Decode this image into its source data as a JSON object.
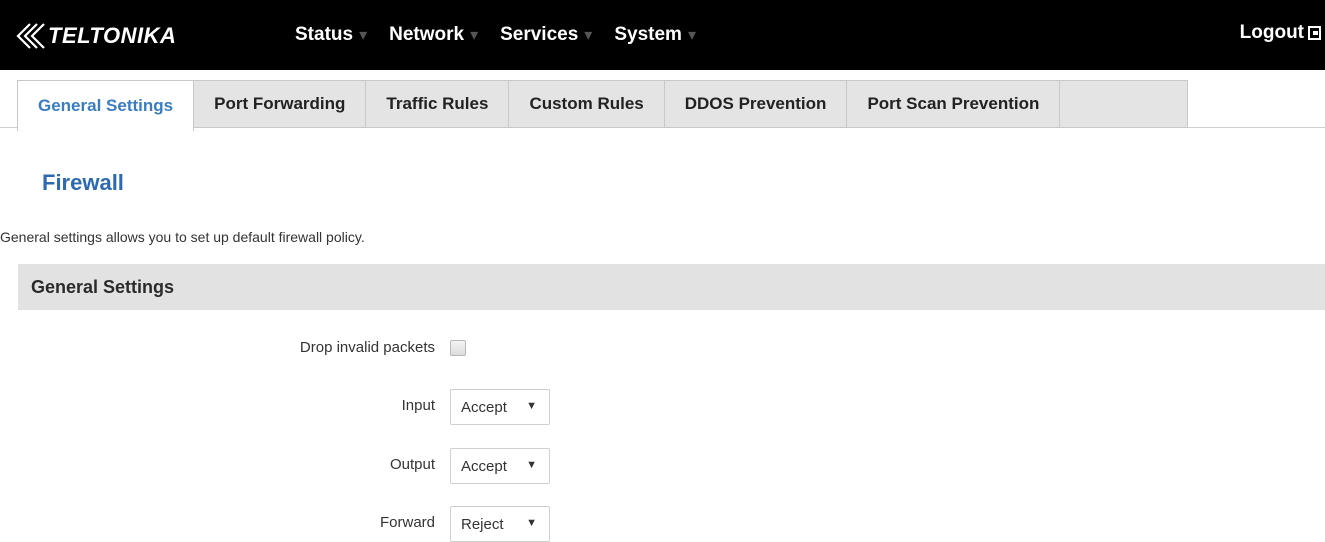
{
  "header": {
    "logo_text": "TELTONIKA",
    "nav": [
      {
        "label": "Status"
      },
      {
        "label": "Network"
      },
      {
        "label": "Services"
      },
      {
        "label": "System"
      }
    ],
    "logout_label": "Logout"
  },
  "tabs": [
    {
      "label": "General Settings",
      "active": true
    },
    {
      "label": "Port Forwarding",
      "active": false
    },
    {
      "label": "Traffic Rules",
      "active": false
    },
    {
      "label": "Custom Rules",
      "active": false
    },
    {
      "label": "DDOS Prevention",
      "active": false
    },
    {
      "label": "Port Scan Prevention",
      "active": false
    }
  ],
  "page": {
    "title": "Firewall",
    "description": "General settings allows you to set up default firewall policy."
  },
  "section": {
    "title": "General Settings",
    "fields": {
      "drop_invalid": {
        "label": "Drop invalid packets",
        "checked": false
      },
      "input": {
        "label": "Input",
        "value": "Accept"
      },
      "output": {
        "label": "Output",
        "value": "Accept"
      },
      "forward": {
        "label": "Forward",
        "value": "Reject"
      }
    }
  },
  "colors": {
    "topbar": "#000000",
    "accent": "#2e6ab0",
    "active_tab_text": "#3a7cc1",
    "tab_bg": "#e4e4e4",
    "section_bg": "#e2e2e2"
  }
}
